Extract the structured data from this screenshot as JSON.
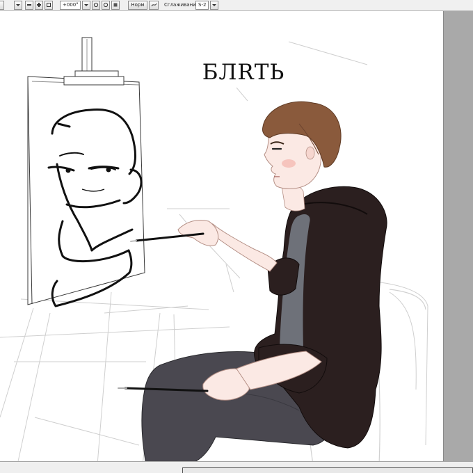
{
  "toolbar": {
    "angle_value": "+000°",
    "blend_mode_label": "Норм",
    "smoothing_label": "Сглаживание",
    "smoothing_value": "S-2"
  },
  "drawing": {
    "caption": "БЛRТЬ"
  },
  "colors": {
    "toolbar_bg": "#f0f0f0",
    "canvas_bg": "#ffffff",
    "workspace_gray": "#a9a9a9",
    "hair": "#8a5a3c",
    "hoodie": "#2b1f1f",
    "tshirt": "#6e7179",
    "pants": "#4a4850",
    "skin": "#fbe9e4",
    "ink": "#111111"
  }
}
